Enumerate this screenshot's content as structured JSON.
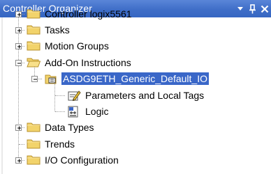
{
  "window": {
    "title": "Controller Organizer",
    "buttons": {
      "dropdown": "dropdown-arrow-icon",
      "pin": "pin-icon",
      "close": "close-icon"
    }
  },
  "colors": {
    "titlebar": "#3f6ec8",
    "selection": "#3a67c8",
    "folder": "#f2d36b"
  },
  "tree": {
    "items": [
      {
        "label": "Controller logix5561",
        "expander": "plus",
        "icon": "folder-icon",
        "level": 0
      },
      {
        "label": "Tasks",
        "expander": "plus",
        "icon": "folder-icon",
        "level": 0
      },
      {
        "label": "Motion Groups",
        "expander": "plus",
        "icon": "folder-icon",
        "level": 0
      },
      {
        "label": "Add-On Instructions",
        "expander": "minus",
        "icon": "open-folder-icon",
        "level": 0
      },
      {
        "label": "ASDG9ETH_Generic_Default_IO",
        "expander": "minus",
        "icon": "add-on-instruction-icon",
        "level": 1,
        "selected": true
      },
      {
        "label": "Parameters and Local Tags",
        "expander": "none",
        "icon": "parameters-tags-icon",
        "level": 2
      },
      {
        "label": "Logic",
        "expander": "none",
        "icon": "logic-icon",
        "level": 2
      },
      {
        "label": "Data Types",
        "expander": "plus",
        "icon": "folder-icon",
        "level": 0
      },
      {
        "label": "Trends",
        "expander": "none",
        "icon": "folder-icon",
        "level": 0
      },
      {
        "label": "I/O Configuration",
        "expander": "plus",
        "icon": "folder-icon",
        "level": 0
      }
    ]
  }
}
